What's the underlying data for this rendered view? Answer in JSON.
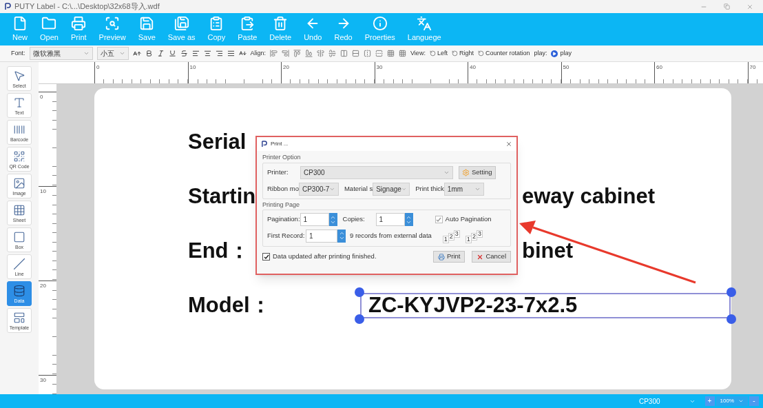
{
  "window": {
    "title": "PUTY Label - C:\\...\\Desktop\\32x68导入.wdf"
  },
  "ribbon": [
    "New",
    "Open",
    "Print",
    "Preview",
    "Save",
    "Save as",
    "Copy",
    "Paste",
    "Delete",
    "Undo",
    "Redo",
    "Proerties",
    "Languege"
  ],
  "format_bar": {
    "font_label": "Font:",
    "font": "微软雅黑",
    "size": "小五",
    "align_label": "Align:",
    "view_label": "View:",
    "view_items": [
      "Left",
      "Right",
      "Counter rotation"
    ],
    "play_label": "play:",
    "play": "play"
  },
  "tools": [
    {
      "label": "Select",
      "selected": false
    },
    {
      "label": "Text",
      "selected": false
    },
    {
      "label": "Barcode",
      "selected": false
    },
    {
      "label": "QR Code",
      "selected": false
    },
    {
      "label": "Image",
      "selected": false
    },
    {
      "label": "Sheet",
      "selected": false
    },
    {
      "label": "Box",
      "selected": false
    },
    {
      "label": "Line",
      "selected": false
    },
    {
      "label": "Data",
      "selected": true
    },
    {
      "label": "Template",
      "selected": false
    }
  ],
  "ruler": {
    "horizontal": [
      "0",
      "10",
      "20",
      "30",
      "40",
      "50",
      "60",
      "70"
    ],
    "vertical": [
      "0",
      "10",
      "20",
      "30"
    ]
  },
  "canvas_rows": [
    {
      "label": "Serial"
    },
    {
      "label": "Startin",
      "value": "eway cabinet",
      "kind": "text"
    },
    {
      "label": "End：",
      "value": "binet",
      "kind": "text"
    },
    {
      "label": "Model：",
      "value": "ZC-KYJVP2-23-7x2.5",
      "kind": "field",
      "selected": true
    }
  ],
  "dialog": {
    "title": "Print ...",
    "printer_group": "Printer Option",
    "printer_label": "Printer:",
    "printer": "CP300",
    "setting": "Setting",
    "options": [
      {
        "label": "Ribbon mo",
        "value": "CP300-7"
      },
      {
        "label": "Material s",
        "value": "Signage"
      },
      {
        "label": "Print thick",
        "value": "1mm"
      }
    ],
    "page_group": "Printing Page",
    "pagination_label": "Pagination:",
    "pagination": "1",
    "copies_label": "Copies:",
    "copies": "1",
    "auto_pagination": {
      "label": "Auto Pagination",
      "checked": true
    },
    "first_record_label": "First Record:",
    "first_record": "1",
    "records_note": "9 records from external data",
    "page_order": [
      [
        "1",
        "2",
        "3"
      ],
      [
        "1",
        "2",
        "3"
      ]
    ],
    "update_after": {
      "label": "Data updated after printing finished.",
      "checked": true
    },
    "buttons": [
      "Print",
      "Cancel"
    ]
  },
  "status_bar": {
    "printer": "CP300",
    "zoom": "100%",
    "zoom_in": "+",
    "zoom_out": "-"
  }
}
